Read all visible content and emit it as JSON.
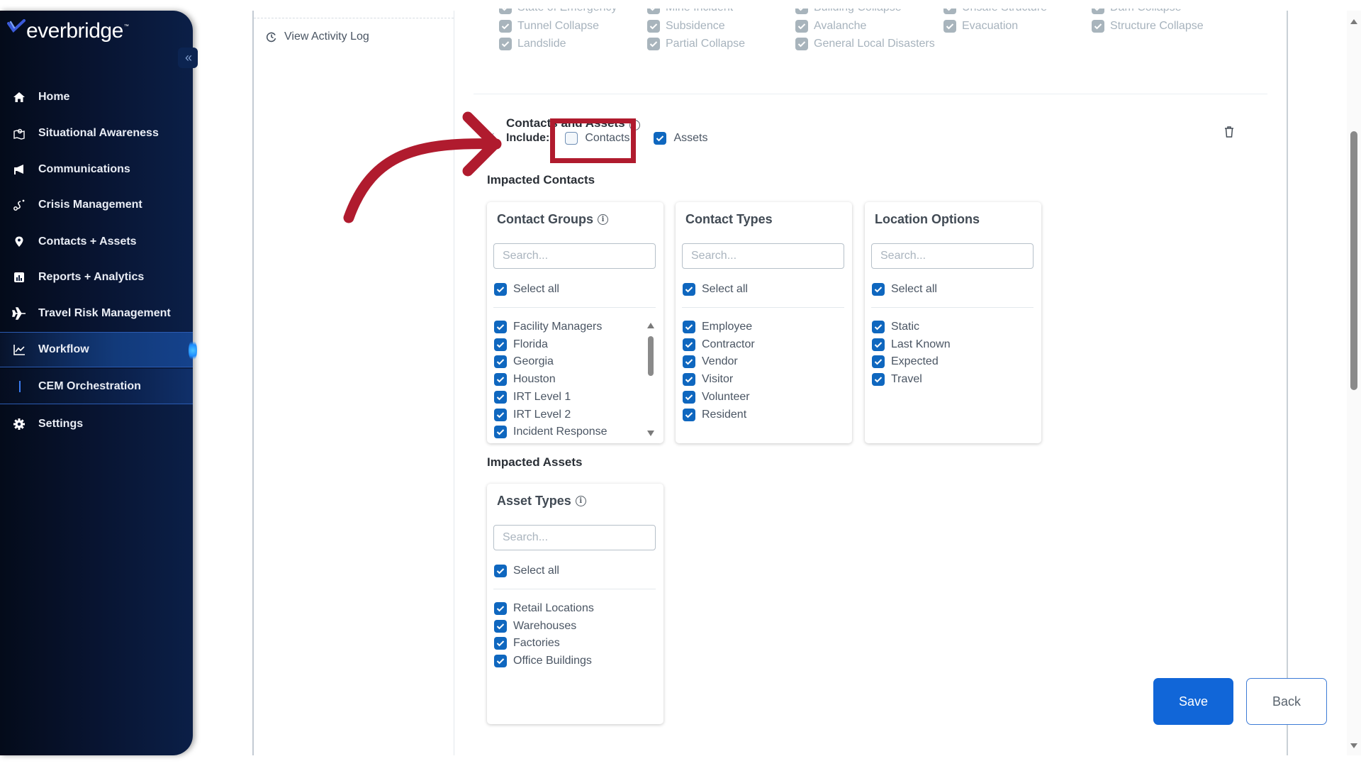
{
  "brand": {
    "name": "everbridge",
    "trademark": "™"
  },
  "sidebar": {
    "collapse_label": "«",
    "items": [
      {
        "label": "Home",
        "icon": "home-icon"
      },
      {
        "label": "Situational Awareness",
        "icon": "map-pin-icon"
      },
      {
        "label": "Communications",
        "icon": "megaphone-icon"
      },
      {
        "label": "Crisis Management",
        "icon": "route-icon"
      },
      {
        "label": "Contacts + Assets",
        "icon": "location-pin-icon"
      },
      {
        "label": "Reports + Analytics",
        "icon": "bar-chart-icon"
      },
      {
        "label": "Travel Risk Management",
        "icon": "airplane-icon"
      },
      {
        "label": "Workflow",
        "icon": "line-chart-icon",
        "active": true
      },
      {
        "label": "CEM Orchestration",
        "sub": true,
        "selected": true
      },
      {
        "label": "Settings",
        "icon": "gear-icon"
      }
    ]
  },
  "left_panel": {
    "activity_log_label": "View Activity Log"
  },
  "hazards": {
    "rows": [
      [
        "State of Emergency",
        "Mine Incident",
        "Building Collapse",
        "Unsafe Structure",
        "Dam Collapse"
      ],
      [
        "Tunnel Collapse",
        "Subsidence",
        "Avalanche",
        "Evacuation",
        "Structure Collapse"
      ],
      [
        "Landslide",
        "Partial Collapse",
        "General Local Disasters",
        "",
        ""
      ]
    ],
    "checked": true,
    "disabled": true
  },
  "contacts_assets": {
    "title": "Contacts and Assets",
    "include_label": "Include:",
    "include_options": [
      {
        "label": "Contacts",
        "checked": false
      },
      {
        "label": "Assets",
        "checked": true
      }
    ],
    "impacted_contacts_heading": "Impacted Contacts",
    "impacted_assets_heading": "Impacted Assets",
    "cards": [
      {
        "title": "Contact Groups",
        "info": true,
        "search_placeholder": "Search...",
        "select_all_label": "Select all",
        "select_all_checked": true,
        "items": [
          "Facility Managers",
          "Florida",
          "Georgia",
          "Houston",
          "IRT Level 1",
          "IRT Level 2",
          "Incident Response"
        ],
        "scrollable": true
      },
      {
        "title": "Contact Types",
        "info": false,
        "search_placeholder": "Search...",
        "select_all_label": "Select all",
        "select_all_checked": true,
        "items": [
          "Employee",
          "Contractor",
          "Vendor",
          "Visitor",
          "Volunteer",
          "Resident"
        ]
      },
      {
        "title": "Location Options",
        "info": false,
        "search_placeholder": "Search...",
        "select_all_label": "Select all",
        "select_all_checked": true,
        "items": [
          "Static",
          "Last Known",
          "Expected",
          "Travel"
        ]
      },
      {
        "title": "Asset Types",
        "info": true,
        "search_placeholder": "Search...",
        "select_all_label": "Select all",
        "select_all_checked": true,
        "items": [
          "Retail Locations",
          "Warehouses",
          "Factories",
          "Office Buildings"
        ]
      }
    ]
  },
  "actions": {
    "save_label": "Save",
    "back_label": "Back"
  },
  "colors": {
    "primary": "#1166d8",
    "checkbox": "#0f67bf",
    "annotation": "#b01b2e",
    "sidebar_bg": "#081431"
  }
}
